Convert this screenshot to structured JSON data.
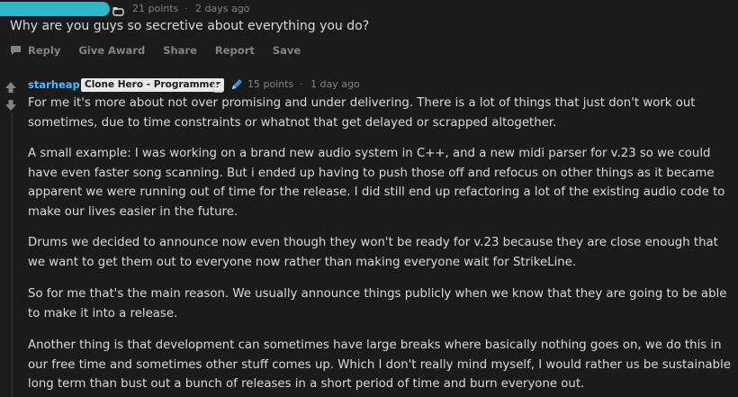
{
  "parent_comment": {
    "points": "21 points",
    "separator": "·",
    "time": "2 days ago",
    "text": "Why are you guys so secretive about everything you do?",
    "actions": {
      "reply": "Reply",
      "give_award": "Give Award",
      "share": "Share",
      "report": "Report",
      "save": "Save"
    }
  },
  "reply_comment": {
    "author": "starheap",
    "flair": "Clone Hero - Programmer",
    "points": "15 points",
    "separator": "·",
    "time": "1 day ago",
    "paragraphs": [
      "For me it's more about not over promising and under delivering. There is a lot of things that just don't work out sometimes, due to time constraints or whatnot that get delayed or scrapped altogether.",
      "A small example: I was working on a brand new audio system in C++, and a new midi parser for v.23 so we could have even faster song scanning. But i ended up having to push those off and refocus on other things as it became apparent we were running out of time for the release. I did still end up refactoring a lot of the existing audio code to make our lives easier in the future.",
      "Drums we decided to announce now even though they won't be ready for v.23 because they are close enough that we want to get them out to everyone now rather than making everyone wait for StrikeLine.",
      "So for me that's the main reason. We usually announce things publicly when we know that they are going to be able to make it into a release.",
      "Another thing is that development can sometimes have large breaks where basically nothing goes on, we do this in our free time and sometimes other stuff comes up. Which I don't really mind myself, I would rather us be sustainable long term than bust out a bunch of releases in a short period of time and burn everyone out."
    ]
  },
  "colors": {
    "background": "#1b1b1c",
    "text": "#d7dadc",
    "meta": "#818384",
    "author": "#4fbcff",
    "flair_bg": "#e9e9e9",
    "redaction": "#2db6c9"
  }
}
